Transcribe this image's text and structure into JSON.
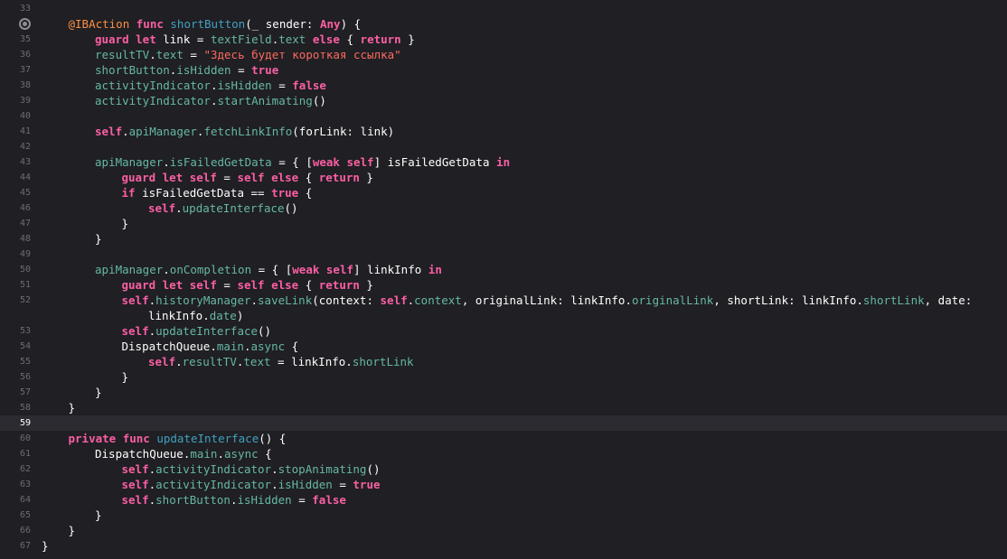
{
  "editor": {
    "language": "swift",
    "current_line": "59",
    "colors": {
      "background": "#1f1f24",
      "current_line_bg": "#2b2b31",
      "keyword": "#fc5fa3",
      "attribute": "#fd8f3f",
      "declaration": "#41a1c0",
      "property": "#67b7a4",
      "string": "#fc6a5d",
      "plain": "#ffffff",
      "line_number": "#6c6c75"
    },
    "lines": [
      {
        "num": "33",
        "indent": 0,
        "tokens": []
      },
      {
        "num": "",
        "breakpoint": true,
        "indent": 1,
        "tokens": [
          [
            "attr",
            "@IBAction"
          ],
          [
            "pl",
            " "
          ],
          [
            "kw",
            "func"
          ],
          [
            "pl",
            " "
          ],
          [
            "decl",
            "shortButton"
          ],
          [
            "pl",
            "(_ sender: "
          ],
          [
            "kw",
            "Any"
          ],
          [
            "pl",
            ") {"
          ]
        ]
      },
      {
        "num": "35",
        "indent": 2,
        "tokens": [
          [
            "kw",
            "guard let"
          ],
          [
            "pl",
            " link = "
          ],
          [
            "prop",
            "textField"
          ],
          [
            "pl",
            "."
          ],
          [
            "prop",
            "text"
          ],
          [
            "pl",
            " "
          ],
          [
            "kw",
            "else"
          ],
          [
            "pl",
            " { "
          ],
          [
            "kw",
            "return"
          ],
          [
            "pl",
            " }"
          ]
        ]
      },
      {
        "num": "36",
        "indent": 2,
        "tokens": [
          [
            "prop",
            "resultTV"
          ],
          [
            "pl",
            "."
          ],
          [
            "prop",
            "text"
          ],
          [
            "pl",
            " = "
          ],
          [
            "str",
            "\"Здесь будет короткая ссылка\""
          ]
        ]
      },
      {
        "num": "37",
        "indent": 2,
        "tokens": [
          [
            "prop",
            "shortButton"
          ],
          [
            "pl",
            "."
          ],
          [
            "prop",
            "isHidden"
          ],
          [
            "pl",
            " = "
          ],
          [
            "kw",
            "true"
          ]
        ]
      },
      {
        "num": "38",
        "indent": 2,
        "tokens": [
          [
            "prop",
            "activityIndicator"
          ],
          [
            "pl",
            "."
          ],
          [
            "prop",
            "isHidden"
          ],
          [
            "pl",
            " = "
          ],
          [
            "kw",
            "false"
          ]
        ]
      },
      {
        "num": "39",
        "indent": 2,
        "tokens": [
          [
            "prop",
            "activityIndicator"
          ],
          [
            "pl",
            "."
          ],
          [
            "prop",
            "startAnimating"
          ],
          [
            "pl",
            "()"
          ]
        ]
      },
      {
        "num": "40",
        "indent": 0,
        "tokens": []
      },
      {
        "num": "41",
        "indent": 2,
        "tokens": [
          [
            "kw",
            "self"
          ],
          [
            "pl",
            "."
          ],
          [
            "prop",
            "apiManager"
          ],
          [
            "pl",
            "."
          ],
          [
            "prop",
            "fetchLinkInfo"
          ],
          [
            "pl",
            "(forLink: link)"
          ]
        ]
      },
      {
        "num": "42",
        "indent": 0,
        "tokens": []
      },
      {
        "num": "43",
        "indent": 2,
        "tokens": [
          [
            "prop",
            "apiManager"
          ],
          [
            "pl",
            "."
          ],
          [
            "prop",
            "isFailedGetData"
          ],
          [
            "pl",
            " = { ["
          ],
          [
            "kw",
            "weak self"
          ],
          [
            "pl",
            "] isFailedGetData "
          ],
          [
            "kw",
            "in"
          ]
        ]
      },
      {
        "num": "44",
        "indent": 3,
        "tokens": [
          [
            "kw",
            "guard let self"
          ],
          [
            "pl",
            " = "
          ],
          [
            "kw",
            "self else"
          ],
          [
            "pl",
            " { "
          ],
          [
            "kw",
            "return"
          ],
          [
            "pl",
            " }"
          ]
        ]
      },
      {
        "num": "45",
        "indent": 3,
        "tokens": [
          [
            "kw",
            "if"
          ],
          [
            "pl",
            " isFailedGetData == "
          ],
          [
            "kw",
            "true"
          ],
          [
            "pl",
            " {"
          ]
        ]
      },
      {
        "num": "46",
        "indent": 4,
        "tokens": [
          [
            "kw",
            "self"
          ],
          [
            "pl",
            "."
          ],
          [
            "prop",
            "updateInterface"
          ],
          [
            "pl",
            "()"
          ]
        ]
      },
      {
        "num": "47",
        "indent": 3,
        "tokens": [
          [
            "pl",
            "}"
          ]
        ]
      },
      {
        "num": "48",
        "indent": 2,
        "tokens": [
          [
            "pl",
            "}"
          ]
        ]
      },
      {
        "num": "49",
        "indent": 0,
        "tokens": []
      },
      {
        "num": "50",
        "indent": 2,
        "tokens": [
          [
            "prop",
            "apiManager"
          ],
          [
            "pl",
            "."
          ],
          [
            "prop",
            "onCompletion"
          ],
          [
            "pl",
            " = { ["
          ],
          [
            "kw",
            "weak self"
          ],
          [
            "pl",
            "] linkInfo "
          ],
          [
            "kw",
            "in"
          ]
        ]
      },
      {
        "num": "51",
        "indent": 3,
        "tokens": [
          [
            "kw",
            "guard let self"
          ],
          [
            "pl",
            " = "
          ],
          [
            "kw",
            "self else"
          ],
          [
            "pl",
            " { "
          ],
          [
            "kw",
            "return"
          ],
          [
            "pl",
            " }"
          ]
        ]
      },
      {
        "num": "52",
        "indent": 3,
        "tokens": [
          [
            "kw",
            "self"
          ],
          [
            "pl",
            "."
          ],
          [
            "prop",
            "historyManager"
          ],
          [
            "pl",
            "."
          ],
          [
            "prop",
            "saveLink"
          ],
          [
            "pl",
            "(context: "
          ],
          [
            "kw",
            "self"
          ],
          [
            "pl",
            "."
          ],
          [
            "prop",
            "context"
          ],
          [
            "pl",
            ", originalLink: linkInfo."
          ],
          [
            "prop",
            "originalLink"
          ],
          [
            "pl",
            ", shortLink: linkInfo."
          ],
          [
            "prop",
            "shortLink"
          ],
          [
            "pl",
            ", date:"
          ]
        ]
      },
      {
        "num": "",
        "indent": 4,
        "tokens": [
          [
            "pl",
            "linkInfo."
          ],
          [
            "prop",
            "date"
          ],
          [
            "pl",
            ")"
          ]
        ]
      },
      {
        "num": "53",
        "indent": 3,
        "tokens": [
          [
            "kw",
            "self"
          ],
          [
            "pl",
            "."
          ],
          [
            "prop",
            "updateInterface"
          ],
          [
            "pl",
            "()"
          ]
        ]
      },
      {
        "num": "54",
        "indent": 3,
        "tokens": [
          [
            "pl",
            "DispatchQueue."
          ],
          [
            "prop",
            "main"
          ],
          [
            "pl",
            "."
          ],
          [
            "prop",
            "async"
          ],
          [
            "pl",
            " {"
          ]
        ]
      },
      {
        "num": "55",
        "indent": 4,
        "tokens": [
          [
            "kw",
            "self"
          ],
          [
            "pl",
            "."
          ],
          [
            "prop",
            "resultTV"
          ],
          [
            "pl",
            "."
          ],
          [
            "prop",
            "text"
          ],
          [
            "pl",
            " = linkInfo."
          ],
          [
            "prop",
            "shortLink"
          ]
        ]
      },
      {
        "num": "56",
        "indent": 3,
        "tokens": [
          [
            "pl",
            "}"
          ]
        ]
      },
      {
        "num": "57",
        "indent": 2,
        "tokens": [
          [
            "pl",
            "}"
          ]
        ]
      },
      {
        "num": "58",
        "indent": 1,
        "tokens": [
          [
            "pl",
            "}"
          ]
        ]
      },
      {
        "num": "59",
        "indent": 0,
        "current": true,
        "tokens": []
      },
      {
        "num": "60",
        "indent": 1,
        "tokens": [
          [
            "kw",
            "private func"
          ],
          [
            "pl",
            " "
          ],
          [
            "decl",
            "updateInterface"
          ],
          [
            "pl",
            "() {"
          ]
        ]
      },
      {
        "num": "61",
        "indent": 2,
        "tokens": [
          [
            "pl",
            "DispatchQueue."
          ],
          [
            "prop",
            "main"
          ],
          [
            "pl",
            "."
          ],
          [
            "prop",
            "async"
          ],
          [
            "pl",
            " {"
          ]
        ]
      },
      {
        "num": "62",
        "indent": 3,
        "tokens": [
          [
            "kw",
            "self"
          ],
          [
            "pl",
            "."
          ],
          [
            "prop",
            "activityIndicator"
          ],
          [
            "pl",
            "."
          ],
          [
            "prop",
            "stopAnimating"
          ],
          [
            "pl",
            "()"
          ]
        ]
      },
      {
        "num": "63",
        "indent": 3,
        "tokens": [
          [
            "kw",
            "self"
          ],
          [
            "pl",
            "."
          ],
          [
            "prop",
            "activityIndicator"
          ],
          [
            "pl",
            "."
          ],
          [
            "prop",
            "isHidden"
          ],
          [
            "pl",
            " = "
          ],
          [
            "kw",
            "true"
          ]
        ]
      },
      {
        "num": "64",
        "indent": 3,
        "tokens": [
          [
            "kw",
            "self"
          ],
          [
            "pl",
            "."
          ],
          [
            "prop",
            "shortButton"
          ],
          [
            "pl",
            "."
          ],
          [
            "prop",
            "isHidden"
          ],
          [
            "pl",
            " = "
          ],
          [
            "kw",
            "false"
          ]
        ]
      },
      {
        "num": "65",
        "indent": 2,
        "tokens": [
          [
            "pl",
            "}"
          ]
        ]
      },
      {
        "num": "66",
        "indent": 1,
        "tokens": [
          [
            "pl",
            "}"
          ]
        ]
      },
      {
        "num": "67",
        "indent": 0,
        "tokens": [
          [
            "pl",
            "}"
          ]
        ]
      }
    ]
  }
}
